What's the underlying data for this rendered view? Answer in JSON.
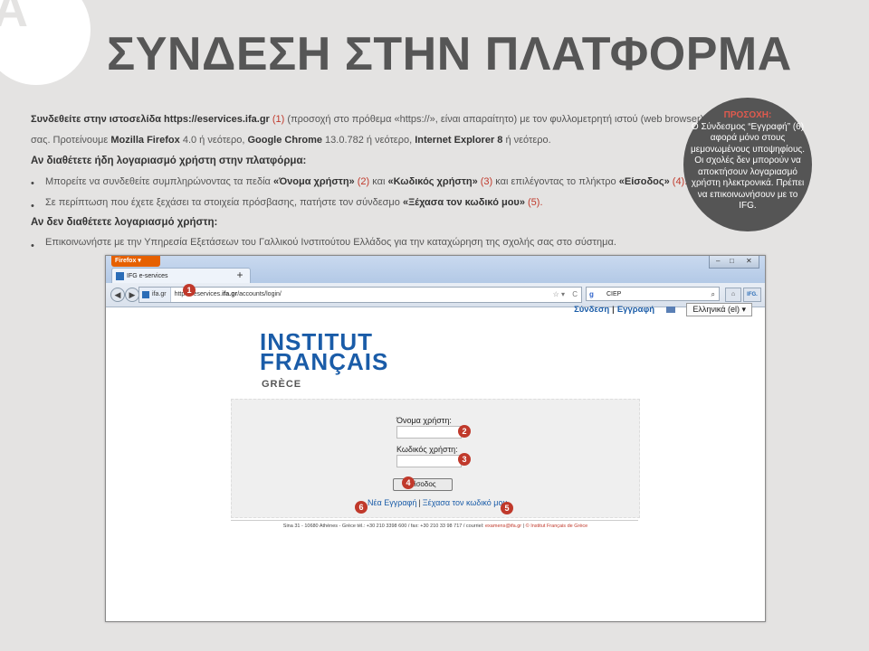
{
  "badge": {
    "letter": "A"
  },
  "title": "ΣΥΝΔΕΣΗ ΣΤΗΝ ΠΛΑΤΦΟΡΜΑ",
  "intro": {
    "p1_bold": "Συνδεθείτε στην ιστοσελίδα https://eservices.ifa.gr",
    "p1_num": "(1)",
    "p1_rest": "(προσοχή στο πρόθεμα «https://», είναι απαραίτητο) με τον φυλλομετρητή ιστού (web browser) της προτίμησής",
    "p2_a": "σας. Προτείνουμε",
    "p2_ff": "Mozilla Firefox",
    "p2_b": "4.0 ή νεότερο,",
    "p2_gc": "Google Chrome",
    "p2_c": "13.0.782 ή νεότερο,",
    "p2_ie": "Internet Explorer 8",
    "p2_d": "ή νεότερο."
  },
  "section1": {
    "heading": "Αν διαθέτετε ήδη λογαριασμό χρήστη στην πλατφόρμα:",
    "b1_a": "Μπορείτε να συνδεθείτε συμπληρώνοντας τα πεδία",
    "b1_user": "«Όνομα χρήστη»",
    "b1_n2": "(2)",
    "b1_and": "και",
    "b1_pass": "«Κωδικός χρήστη»",
    "b1_n3": "(3)",
    "b1_b": "και επιλέγοντας το πλήκτρο",
    "b1_login": "«Είσοδος»",
    "b1_n4": "(4).",
    "b2_a": "Σε περίπτωση που έχετε ξεχάσει τα στοιχεία πρόσβασης, πατήστε τον σύνδεσμο",
    "b2_link": "«Ξέχασα τον κωδικό μου»",
    "b2_n5": "(5)."
  },
  "section2": {
    "heading": "Αν δεν διαθέτετε λογαριασμό χρήστη:",
    "b1": "Επικοινωνήστε με την Υπηρεσία Εξετάσεων του Γαλλικού Ινστιτούτου Ελλάδος για την καταχώρηση της σχολής σας στο σύστημα."
  },
  "notice": {
    "heading": "ΠΡΟΣΟΧΗ:",
    "body": "Ο Σύνδεσμος “Εγγραφή” (6) αφορά μόνο στους μεμονωμένους υποψηφίους. Οι σχολές δεν μπορούν να αποκτήσουν λογαριασμό χρήστη ηλεκτρονικά. Πρέπει να επικοινωνήσουν με το IFG."
  },
  "browser": {
    "app_button": "Firefox",
    "tab_title": "IFG e-services",
    "new_tab": "+",
    "url_site": "ifa.gr",
    "url_prefix": "https://e",
    "url_host_bold": "ifa.gr",
    "url_path": "/accounts/login/",
    "host_prefix": "services.",
    "search_value": "CIEP",
    "ext_label": "IFG.",
    "top_nav": {
      "login": "Σύνδεση",
      "sep": "|",
      "register": "Εγγραφή",
      "language": "Ελληνικά (el)"
    },
    "logo": {
      "line1": "INSTITUT",
      "line2": "FRANÇAIS",
      "line3": "GRÈCE"
    },
    "form": {
      "username_label": "Όνομα χρήστη:",
      "password_label": "Κωδικός χρήστη:",
      "login_button": "Είσοδος",
      "new_registration": "Νέα Εγγραφή",
      "sep": "|",
      "forgot_password": "Ξέχασα τον κωδικό μου"
    },
    "footer": {
      "text": "Sina 31 - 10680 Athènes - Grèce tél.: +30 210 3398 600 / fax: +30 210 33 98 717 / courriel:",
      "email": "examens@ifa.gr",
      "sep": "|",
      "link": "© Institut Français de Grèce"
    }
  },
  "markers": [
    "1",
    "2",
    "3",
    "4",
    "5",
    "6"
  ],
  "colors": {
    "accent_red": "#c0392b",
    "link_blue": "#1a5ca8",
    "background": "#e4e3e2",
    "notice_bg": "#555555"
  }
}
